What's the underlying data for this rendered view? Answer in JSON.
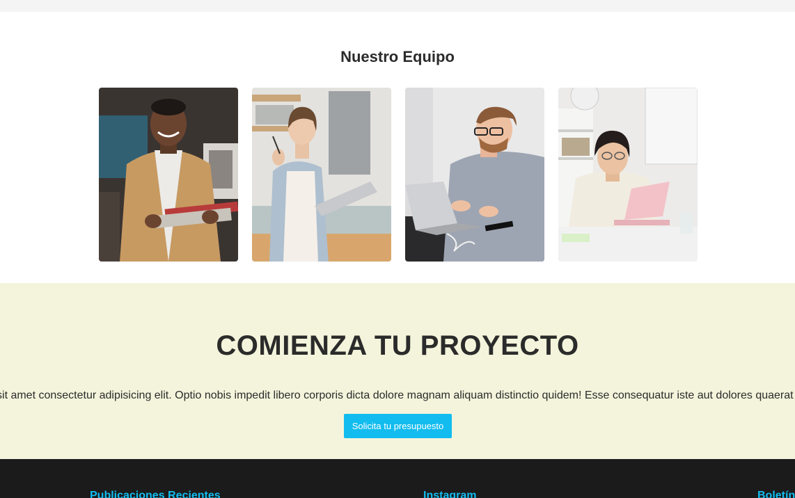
{
  "team": {
    "title": "Nuestro Equipo",
    "members": [
      {
        "photo": "man-in-tan-blazer-holding-magazine"
      },
      {
        "photo": "woman-holding-glasses-and-laptop"
      },
      {
        "photo": "man-with-glasses-typing-on-laptop"
      },
      {
        "photo": "woman-in-white-jacket-at-pink-laptop"
      }
    ]
  },
  "cta": {
    "title": "COMIENZA TU PROYECTO",
    "text": "Lorem ipsum dolor sit amet consectetur adipisicing elit. Optio nobis impedit libero corporis dicta dolore magnam aliquam distinctio quidem! Esse consequatur iste aut dolores quaerat beatae perferendis.",
    "button_label": "Solicita tu presupuesto"
  },
  "footer": {
    "headings": [
      "Publicaciones Recientes",
      "Instagram",
      "Boletín"
    ]
  },
  "colors": {
    "accent": "#12bcef",
    "cta_background": "#f4f4dc",
    "footer_background": "#1b1b1c",
    "heading_text": "#2b2b2b"
  }
}
